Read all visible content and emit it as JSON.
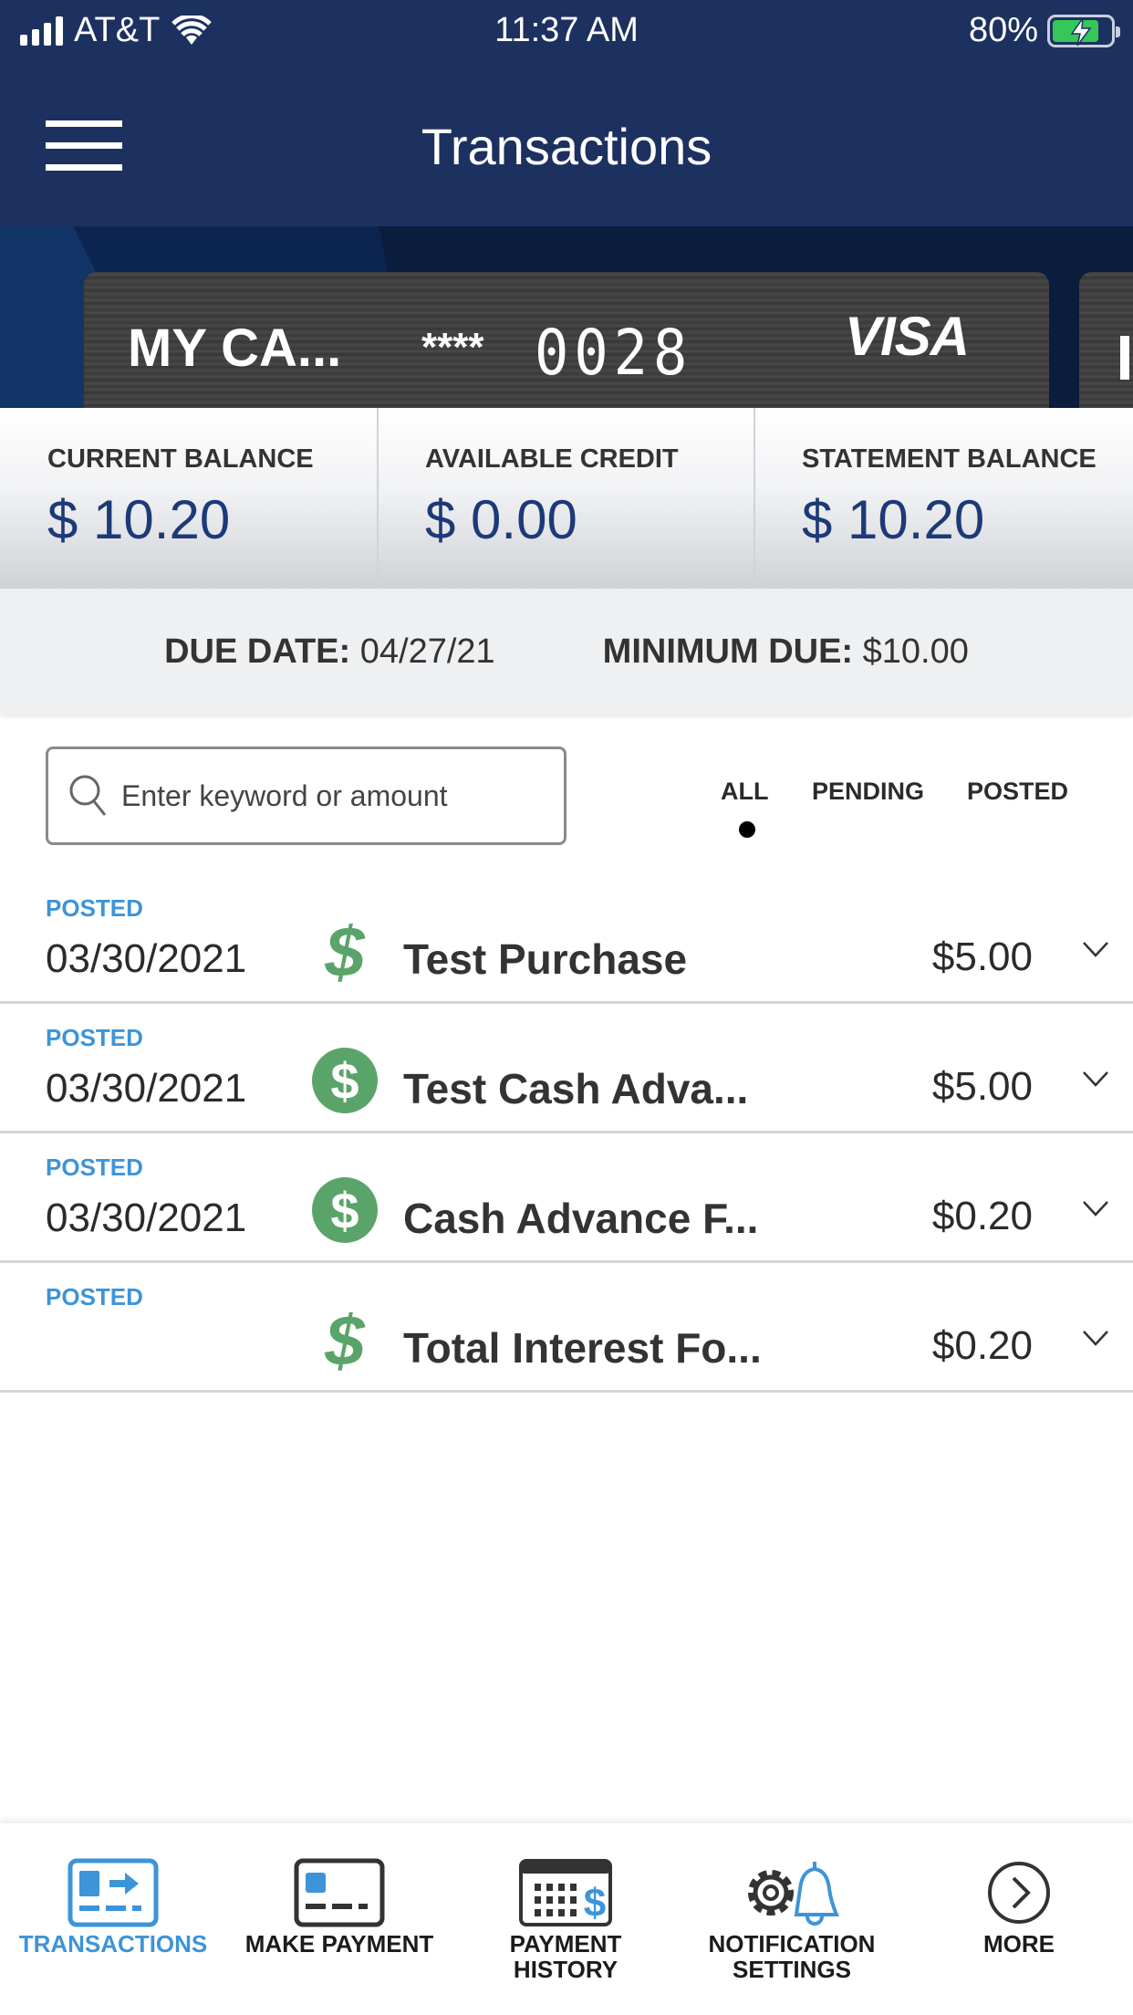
{
  "status_bar": {
    "carrier": "AT&T",
    "time": "11:37 AM",
    "battery_percent": "80%",
    "battery_level": 0.8,
    "charging": true
  },
  "header": {
    "title": "Transactions",
    "menu_icon": "hamburger-menu-icon"
  },
  "card": {
    "name": "MY CA...",
    "mask": "****",
    "last4": "0028",
    "brand": "VISA"
  },
  "balances": [
    {
      "label": "CURRENT BALANCE",
      "value": "$ 10.20"
    },
    {
      "label": "AVAILABLE CREDIT",
      "value": "$ 0.00"
    },
    {
      "label": "STATEMENT BALANCE",
      "value": "$ 10.20"
    }
  ],
  "due": {
    "due_date_label": "DUE DATE:",
    "due_date_value": "04/27/21",
    "minimum_due_label": "MINIMUM DUE:",
    "minimum_due_value": "$10.00"
  },
  "search": {
    "placeholder": "Enter keyword or amount",
    "value": "",
    "icon": "search-icon"
  },
  "filters": {
    "items": [
      "ALL",
      "PENDING",
      "POSTED"
    ],
    "selected": "ALL"
  },
  "transactions": [
    {
      "status": "POSTED",
      "date": "03/30/2021",
      "icon": "dollar-sign-icon",
      "description": "Test Purchase",
      "amount": "$5.00"
    },
    {
      "status": "POSTED",
      "date": "03/30/2021",
      "icon": "dollar-circle-icon",
      "description": "Test Cash Adva...",
      "amount": "$5.00"
    },
    {
      "status": "POSTED",
      "date": "03/30/2021",
      "icon": "dollar-circle-icon",
      "description": "Cash Advance F...",
      "amount": "$0.20"
    },
    {
      "status": "POSTED",
      "date": "",
      "icon": "dollar-sign-icon",
      "description": "Total Interest Fo...",
      "amount": "$0.20"
    }
  ],
  "bottom_nav": {
    "active": "TRANSACTIONS",
    "items": [
      {
        "label": "TRANSACTIONS",
        "icon": "transactions-card-arrow-icon"
      },
      {
        "label": "MAKE PAYMENT",
        "icon": "credit-card-icon"
      },
      {
        "label": "PAYMENT\nHISTORY",
        "label_line1": "PAYMENT",
        "label_line2": "HISTORY",
        "icon": "calendar-dollar-icon"
      },
      {
        "label": "NOTIFICATION\nSETTINGS",
        "label_line1": "NOTIFICATION",
        "label_line2": "SETTINGS",
        "icon": "gear-bell-icon"
      },
      {
        "label": "MORE",
        "icon": "chevron-right-circle-icon"
      }
    ]
  },
  "colors": {
    "header_bg": "#1d3160",
    "accent_blue": "#3d94d8",
    "balance_value": "#1d3a78",
    "icon_green": "#5aa469"
  }
}
